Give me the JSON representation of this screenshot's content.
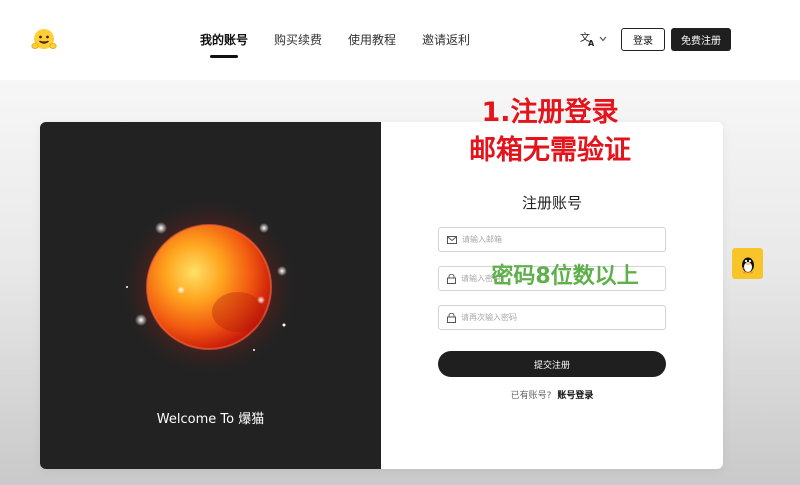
{
  "header": {
    "nav": [
      "我的账号",
      "购买续费",
      "使用教程",
      "邀请返利"
    ],
    "active_index": 0,
    "lang_icon": "translate-icon",
    "login_label": "登录",
    "register_label": "免费注册"
  },
  "left_panel": {
    "welcome_text": "Welcome To 爆猫"
  },
  "form": {
    "title": "注册账号",
    "email_placeholder": "请输入邮箱",
    "password_placeholder": "请输入密码",
    "password_confirm_placeholder": "请再次输入密码",
    "submit_label": "提交注册",
    "have_account_text": "已有账号?",
    "login_link": "账号登录"
  },
  "annotations": {
    "red_line1": "1.注册登录",
    "red_line2": "邮箱无需验证",
    "green_text": "密码8位数以上"
  },
  "colors": {
    "accent_dark": "#1f1f1f",
    "annotation_red": "#e3141b",
    "annotation_green": "#5fb04b",
    "qq_yellow": "#f7c52a"
  }
}
